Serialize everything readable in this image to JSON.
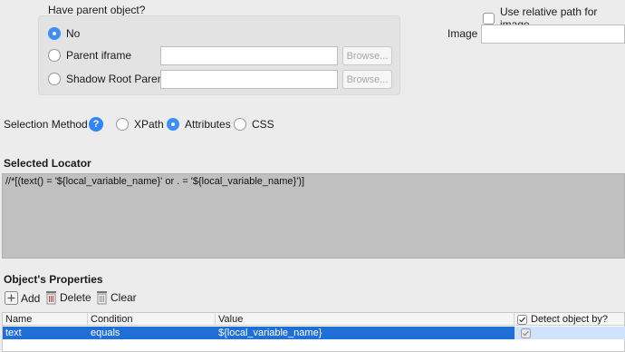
{
  "parent_object": {
    "label": "Have parent object?",
    "options": [
      {
        "label": "No",
        "selected": true
      },
      {
        "label": "Parent iframe",
        "selected": false
      },
      {
        "label": "Shadow Root Parent",
        "selected": false
      }
    ],
    "browse_label": "Browse..."
  },
  "relative_path": {
    "label": "Use relative path for image",
    "checked": false
  },
  "image": {
    "label": "Image",
    "value": ""
  },
  "selection_method": {
    "label": "Selection Method",
    "help": "?",
    "options": [
      {
        "label": "XPath",
        "selected": false
      },
      {
        "label": "Attributes",
        "selected": true
      },
      {
        "label": "CSS",
        "selected": false
      }
    ]
  },
  "selected_locator": {
    "title": "Selected Locator",
    "value": "//*[(text() = '${local_variable_name}' or . = '${local_variable_name}')]"
  },
  "properties": {
    "title": "Object's Properties",
    "toolbar": {
      "add": "Add",
      "delete": "Delete",
      "clear": "Clear"
    },
    "columns": [
      "Name",
      "Condition",
      "Value",
      "Detect object by?"
    ],
    "rows": [
      {
        "name": "text",
        "condition": "equals",
        "value": "${local_variable_name}",
        "detect": true
      }
    ]
  },
  "colors": {
    "accent": "#3d8ff6",
    "selection": "#1f6fd6",
    "locator_bg": "#c0c0c0"
  }
}
